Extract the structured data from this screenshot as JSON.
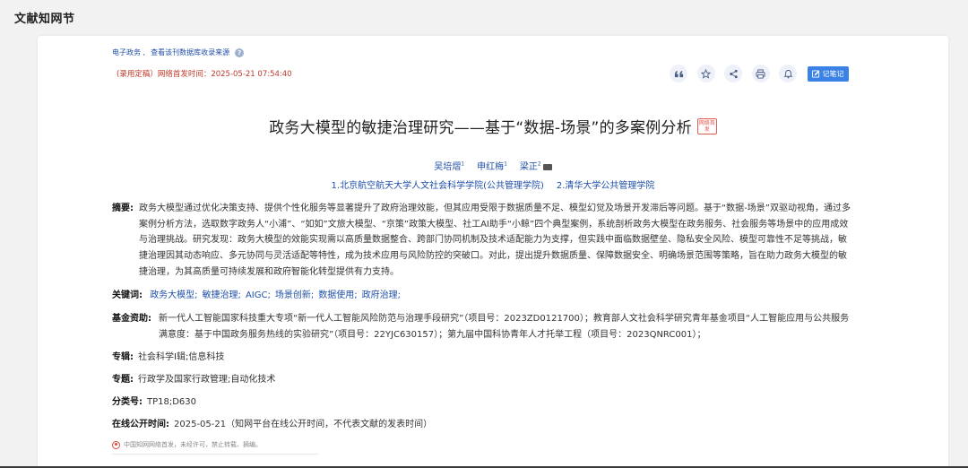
{
  "page": {
    "title": "文献知网节"
  },
  "breadcrumb": {
    "item1": "电子政务 ,",
    "item2": "查看该刊数据库收录来源"
  },
  "publish_info": "(录用定稿）网络首发时间：2025-05-21 07:54:40",
  "toolbar": {
    "icons": [
      "quote-icon",
      "star-icon",
      "share-icon",
      "print-icon",
      "bell-icon"
    ],
    "note_label": "记笔记"
  },
  "article": {
    "title": "政务大模型的敏捷治理研究——基于“数据-场景”的多案例分析",
    "first_badge": "网络首发",
    "authors": [
      {
        "name": "吴培熠",
        "sup": "1"
      },
      {
        "name": "申红梅",
        "sup": "1"
      },
      {
        "name": "梁正",
        "sup": "2"
      }
    ],
    "affiliations": [
      "1.北京航空航天大学人文社会科学学院(公共管理学院)",
      "2.清华大学公共管理学院"
    ]
  },
  "abstract": {
    "label": "摘要:",
    "text": "政务大模型通过优化决策支持、提供个性化服务等显著提升了政府治理效能，但其应用受限于数据质量不足、模型幻觉及场景开发滞后等问题。基于“数据-场景”双驱动视角，通过多案例分析方法，选取数字政务人“小浦”、“如如”文旅大模型、“京策”政策大模型、社工AI助手“小鲸”四个典型案例，系统剖析政务大模型在政务服务、社会服务等场景中的应用成效与治理挑战。研究发现：政务大模型的效能实现需以高质量数据整合、跨部门协同机制及技术适配能力为支撑，但实践中面临数据壁垒、隐私安全风险、模型可靠性不足等挑战，敏捷治理因其动态响应、多元协同与灵活适配等特性，成为技术应用与风险防控的突破口。对此，提出提升数据质量、保障数据安全、明确场景范围等策略，旨在助力政务大模型的敏捷治理，为其高质量可持续发展和政府智能化转型提供有力支持。"
  },
  "keywords": {
    "label": "关键词:",
    "items": [
      "政务大模型;",
      "敏捷治理;",
      "AIGC;",
      "场景创新;",
      "数据使用;",
      "政府治理;"
    ]
  },
  "funding": {
    "label": "基金资助:",
    "text": "新一代人工智能国家科技重大专项“新一代人工智能风险防范与治理手段研究”（项目号：2023ZD0121700）；教育部人文社会科学研究青年基金项目“人工智能应用与公共服务满意度：基于中国政务服务热线的实验研究”（项目号：22YJC630157）；第九届中国科协青年人才托举工程（项目号：2023QNRC001）；"
  },
  "series": {
    "label": "专辑:",
    "value": "社会科学Ⅰ辑;信息科技"
  },
  "topic": {
    "label": "专题:",
    "value": "行政学及国家行政管理;自动化技术"
  },
  "classification": {
    "label": "分类号:",
    "value": "TP18;D630"
  },
  "online_time": {
    "label": "在线公开时间:",
    "value": "2025-05-21（知网平台在线公开时间，不代表文献的发表时间）"
  },
  "notice": "中国知网网络首发，未经许可，禁止转载、摘编。"
}
